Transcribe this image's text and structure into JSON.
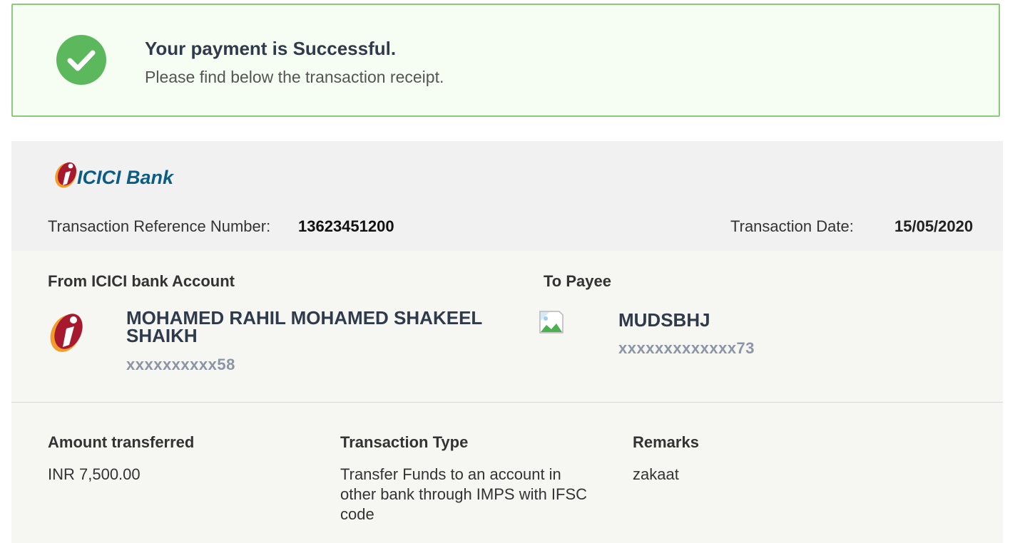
{
  "banner": {
    "title": "Your payment is Successful.",
    "subtitle": "Please find below the transaction receipt.",
    "icon": "check-circle-icon",
    "accent_color": "#5cb85c"
  },
  "receipt": {
    "bank_logo_text": "ICICI Bank",
    "reference_label": "Transaction Reference Number:",
    "reference_value": "13623451200",
    "date_label": "Transaction Date:",
    "date_value": "15/05/2020",
    "from": {
      "heading": "From ICICI bank Account",
      "name": "MOHAMED RAHIL MOHAMED SHAKEEL SHAIKH",
      "account": "xxxxxxxxxx58"
    },
    "to": {
      "heading": "To Payee",
      "name": "MUDSBHJ",
      "account": "xxxxxxxxxxxxx73"
    },
    "details": {
      "amount_heading": "Amount transferred",
      "amount_value": "INR 7,500.00",
      "type_heading": "Transaction Type",
      "type_value": "Transfer Funds to an account in other bank through IMPS with IFSC code",
      "remarks_heading": "Remarks",
      "remarks_value": "zakaat"
    }
  }
}
